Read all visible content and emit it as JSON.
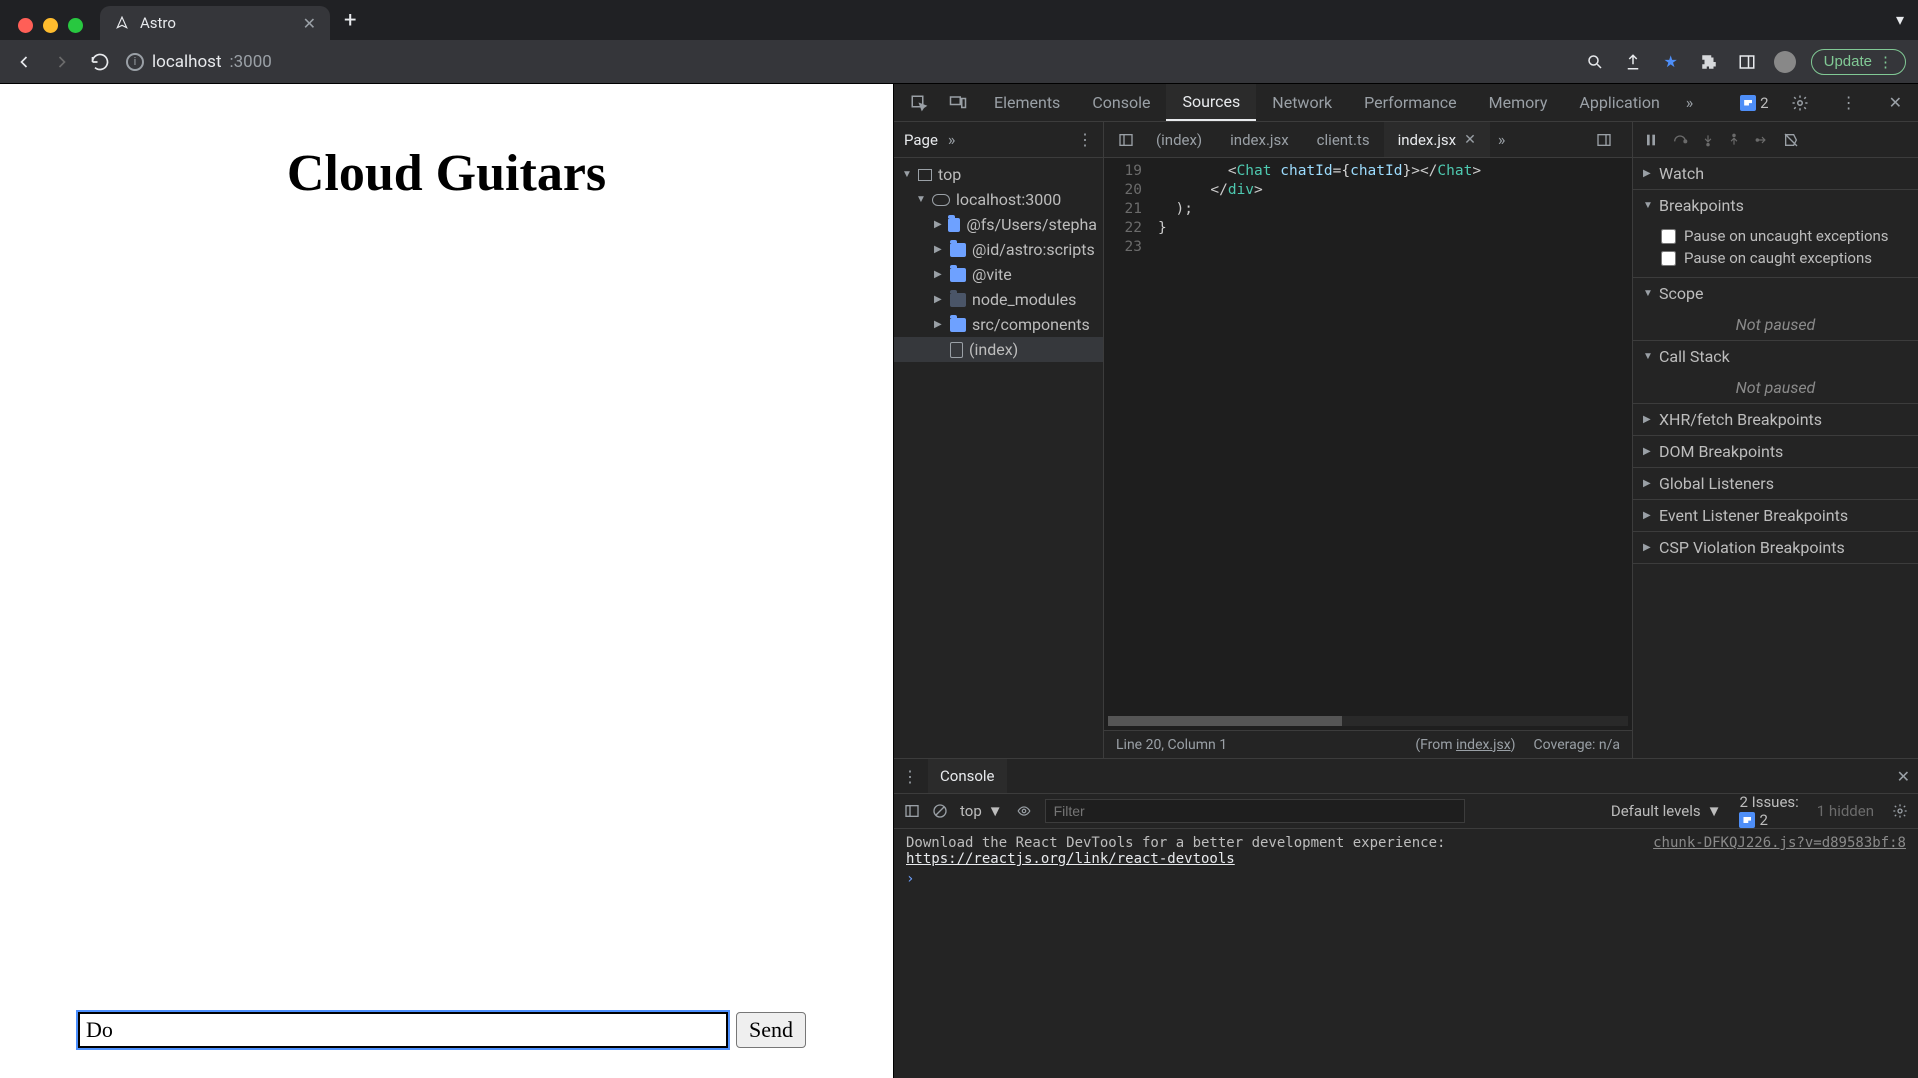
{
  "browser": {
    "tab_title": "Astro",
    "newtab_label": "+",
    "url_host": "localhost",
    "url_port": ":3000",
    "update_label": "Update"
  },
  "page": {
    "heading": "Cloud Guitars",
    "input_value": "Do",
    "send_label": "Send"
  },
  "devtools": {
    "tabs": [
      "Elements",
      "Console",
      "Sources",
      "Network",
      "Performance",
      "Memory",
      "Application"
    ],
    "active_tab": "Sources",
    "issue_count": "2",
    "settings_gear": "gear"
  },
  "navigator": {
    "pane_label": "Page",
    "tree": {
      "top": "top",
      "host": "localhost:3000",
      "items": [
        "@fs/Users/stepha",
        "@id/astro:scripts",
        "@vite",
        "node_modules",
        "src/components",
        "(index)"
      ]
    }
  },
  "file_tabs": {
    "items": [
      "(index)",
      "index.jsx",
      "client.ts",
      "index.jsx"
    ],
    "active_index": 3
  },
  "code": {
    "line_19": "        <Chat chatId={chatId}></Chat>",
    "line_20": "      </div>",
    "line_21": "  );",
    "line_22": "}",
    "gutter": [
      "19",
      "20",
      "21",
      "22",
      "23"
    ]
  },
  "status": {
    "pos": "Line 20, Column 1",
    "from_prefix": "(From ",
    "from_file": "index.jsx",
    "from_suffix": ")",
    "coverage": "Coverage: n/a"
  },
  "debugger": {
    "sections": {
      "watch": "Watch",
      "breakpoints": "Breakpoints",
      "pause_uncaught": "Pause on uncaught exceptions",
      "pause_caught": "Pause on caught exceptions",
      "scope": "Scope",
      "not_paused": "Not paused",
      "callstack": "Call Stack",
      "xhr": "XHR/fetch Breakpoints",
      "dom": "DOM Breakpoints",
      "global": "Global Listeners",
      "event": "Event Listener Breakpoints",
      "csp": "CSP Violation Breakpoints"
    }
  },
  "drawer": {
    "tab": "Console",
    "context": "top",
    "filter_placeholder": "Filter",
    "levels": "Default levels",
    "issues_label": "2 Issues:",
    "issues_count": "2",
    "hidden": "1 hidden",
    "msg_text": "Download the React DevTools for a better development experience: ",
    "msg_link": "https://reactjs.org/link/react-devtools",
    "msg_src": "chunk-DFKQJ226.js?v=d89583bf:8"
  }
}
